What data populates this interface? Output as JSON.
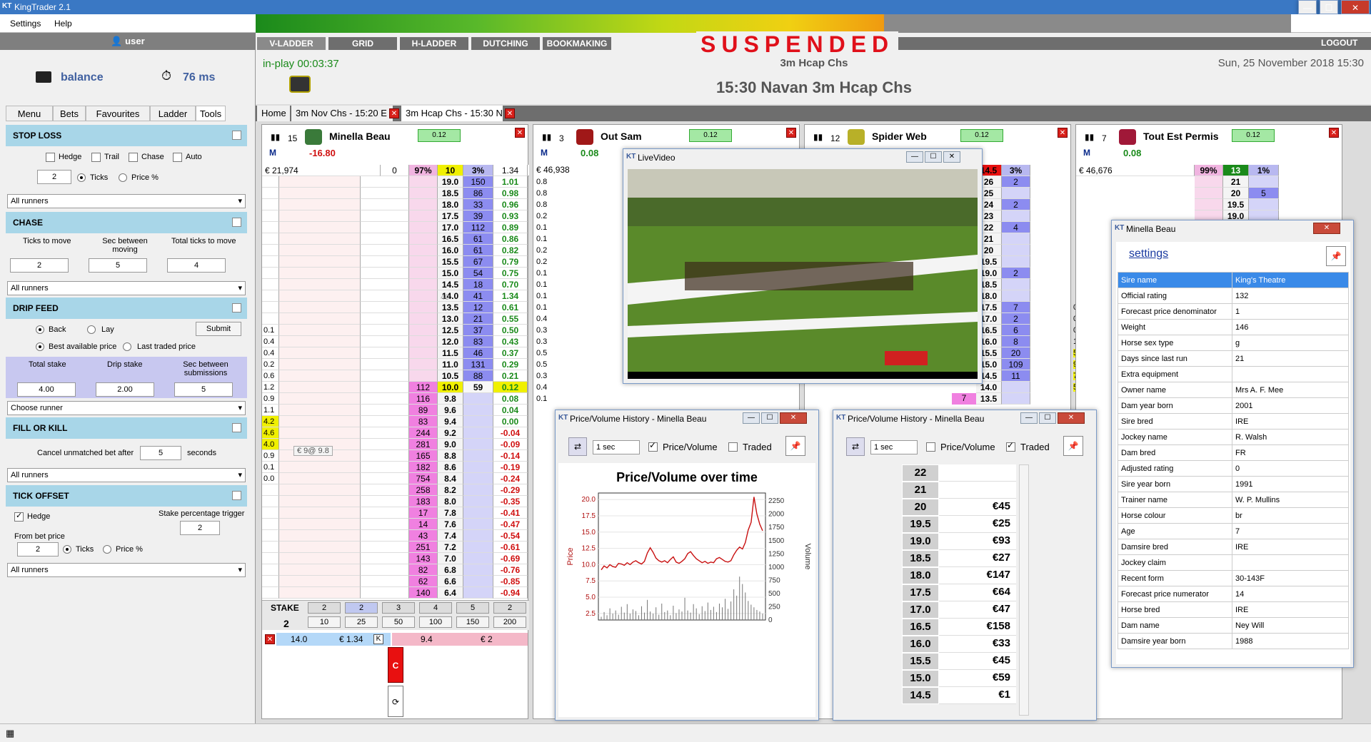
{
  "app": {
    "title": "KingTrader 2.1",
    "logo": "KT"
  },
  "menu": [
    "Settings",
    "Help"
  ],
  "user": {
    "name": "user",
    "balance_label": "balance",
    "latency": "76 ms"
  },
  "left_tabs": [
    "Menu",
    "Bets",
    "Favourites",
    "Ladder",
    "Tools"
  ],
  "stop_loss": {
    "title": "STOP LOSS",
    "hedge": "Hedge",
    "trail": "Trail",
    "chase": "Chase",
    "auto": "Auto",
    "value": "2",
    "ticks": "Ticks",
    "price_pct": "Price %",
    "runners": "All runners"
  },
  "chase": {
    "title": "CHASE",
    "ticks_to_move": "Ticks to move",
    "sec_between": "Sec between moving",
    "total_ticks": "Total ticks to move",
    "v1": "2",
    "v2": "5",
    "v3": "4",
    "runners": "All runners"
  },
  "drip": {
    "title": "DRIP FEED",
    "back": "Back",
    "lay": "Lay",
    "submit": "Submit",
    "best": "Best available price",
    "last": "Last traded price",
    "total_stake": "Total stake",
    "drip_stake": "Drip stake",
    "sec_sub": "Sec between submissions",
    "v1": "4.00",
    "v2": "2.00",
    "v3": "5",
    "runner": "Choose runner"
  },
  "fok": {
    "title": "FILL OR KILL",
    "cancel": "Cancel unmatched bet after",
    "value": "5",
    "seconds": "seconds",
    "runners": "All runners"
  },
  "tick": {
    "title": "TICK OFFSET",
    "hedge": "Hedge",
    "stake_trig": "Stake percentage trigger",
    "trig_val": "2",
    "from": "From bet price",
    "value": "2",
    "ticks": "Ticks",
    "price_pct": "Price %",
    "runners": "All runners"
  },
  "nav": [
    "V-LADDER",
    "GRID",
    "H-LADDER",
    "DUTCHING",
    "BOOKMAKING"
  ],
  "logout": "LOGOUT",
  "status": {
    "suspended": "SUSPENDED",
    "subtitle": "3m Hcap Chs",
    "inplay": "in-play 00:03:37",
    "race": "15:30 Navan 3m Hcap Chs",
    "date": "Sun, 25 November 2018 15:30"
  },
  "doc_tabs": [
    "Home",
    "3m Nov Chs - 15:20 E",
    "3m Hcap Chs - 15:30 N"
  ],
  "runners": [
    {
      "num": "15",
      "name": "Minella Beau",
      "pill": "0.12",
      "pl": "-16.80",
      "total": "€ 21,974",
      "zero": "0",
      "pct1": "97%",
      "ltp": "10",
      "pct2": "3%",
      "v": "1.34"
    },
    {
      "num": "3",
      "name": "Out Sam",
      "pill": "0.12",
      "pl": "0.08",
      "total": "€ 46,938"
    },
    {
      "num": "12",
      "name": "Spider Web",
      "pill": "0.12",
      "pl": "",
      "total": ""
    },
    {
      "num": "7",
      "name": "Tout Est Permis",
      "pill": "0.12",
      "pl": "0.08",
      "total": "€ 46,676",
      "pct1": "99%",
      "ltp": "13",
      "pct2": "1%"
    }
  ],
  "ladder1": [
    {
      "l": "",
      "b": "",
      "p": "19.0",
      "lay": "150",
      "r": "1.01"
    },
    {
      "l": "",
      "b": "",
      "p": "18.5",
      "lay": "86",
      "r": "0.98"
    },
    {
      "l": "",
      "b": "",
      "p": "18.0",
      "lay": "33",
      "r": "0.96"
    },
    {
      "l": "",
      "b": "",
      "p": "17.5",
      "lay": "39",
      "r": "0.93"
    },
    {
      "l": "",
      "b": "",
      "p": "17.0",
      "lay": "112",
      "r": "0.89"
    },
    {
      "l": "",
      "b": "",
      "p": "16.5",
      "lay": "61",
      "r": "0.86"
    },
    {
      "l": "",
      "b": "",
      "p": "16.0",
      "lay": "61",
      "r": "0.82"
    },
    {
      "l": "",
      "b": "",
      "p": "15.5",
      "lay": "67",
      "r": "0.79"
    },
    {
      "l": "",
      "b": "",
      "p": "15.0",
      "lay": "54",
      "r": "0.75"
    },
    {
      "l": "",
      "b": "",
      "p": "14.5",
      "lay": "18",
      "r": "0.70"
    },
    {
      "l": "",
      "b": "",
      "p": "14.0",
      "lay": "41",
      "r": "1.34"
    },
    {
      "l": "",
      "b": "",
      "p": "13.5",
      "lay": "12",
      "r": "0.61"
    },
    {
      "l": "",
      "b": "",
      "p": "13.0",
      "lay": "21",
      "r": "0.55"
    },
    {
      "l": "0.1",
      "b": "",
      "p": "12.5",
      "lay": "37",
      "r": "0.50"
    },
    {
      "l": "0.4",
      "b": "",
      "p": "12.0",
      "lay": "83",
      "r": "0.43"
    },
    {
      "l": "0.4",
      "b": "",
      "p": "11.5",
      "lay": "46",
      "r": "0.37"
    },
    {
      "l": "0.2",
      "b": "",
      "p": "11.0",
      "lay": "131",
      "r": "0.29"
    },
    {
      "l": "0.6",
      "b": "",
      "p": "10.5",
      "lay": "88",
      "r": "0.21"
    },
    {
      "l": "1.2",
      "b": "112",
      "p": "10.0",
      "lay": "59",
      "r": "0.12"
    },
    {
      "l": "0.9",
      "b": "116",
      "p": "9.8",
      "lay": "",
      "r": "0.08"
    },
    {
      "l": "1.1",
      "b": "89",
      "p": "9.6",
      "lay": "",
      "r": "0.04"
    },
    {
      "l": "4.2",
      "b": "83",
      "p": "9.4",
      "lay": "",
      "r": "0.00"
    },
    {
      "l": "4.6",
      "b": "244",
      "p": "9.2",
      "lay": "",
      "r": "-0.04"
    },
    {
      "l": "4.0",
      "b": "281",
      "p": "9.0",
      "lay": "",
      "r": "-0.09"
    },
    {
      "l": "0.9",
      "b": "165",
      "p": "8.8",
      "lay": "",
      "r": "-0.14"
    },
    {
      "l": "0.1",
      "b": "182",
      "p": "8.6",
      "lay": "",
      "r": "-0.19"
    },
    {
      "l": "0.0",
      "b": "754",
      "p": "8.4",
      "lay": "",
      "r": "-0.24"
    },
    {
      "l": "",
      "b": "258",
      "p": "8.2",
      "lay": "",
      "r": "-0.29"
    },
    {
      "l": "",
      "b": "183",
      "p": "8.0",
      "lay": "",
      "r": "-0.35"
    },
    {
      "l": "",
      "b": "17",
      "p": "7.8",
      "lay": "",
      "r": "-0.41"
    },
    {
      "l": "",
      "b": "14",
      "p": "7.6",
      "lay": "",
      "r": "-0.47"
    },
    {
      "l": "",
      "b": "43",
      "p": "7.4",
      "lay": "",
      "r": "-0.54"
    },
    {
      "l": "",
      "b": "251",
      "p": "7.2",
      "lay": "",
      "r": "-0.61"
    },
    {
      "l": "",
      "b": "143",
      "p": "7.0",
      "lay": "",
      "r": "-0.69"
    },
    {
      "l": "",
      "b": "82",
      "p": "6.8",
      "lay": "",
      "r": "-0.76"
    },
    {
      "l": "",
      "b": "62",
      "p": "6.6",
      "lay": "",
      "r": "-0.85"
    },
    {
      "l": "",
      "b": "140",
      "p": "6.4",
      "lay": "",
      "r": "-0.94"
    }
  ],
  "ladder1_extra": {
    "ghost": "40",
    "pos": "€ 9@ 9.8"
  },
  "ladder2_left": [
    "0.8",
    "0.8",
    "0.8",
    "0.2",
    "0.1",
    "0.1",
    "0.2",
    "0.2",
    "0.1",
    "0.1",
    "0.1",
    "0.1",
    "0.4",
    "0.3",
    "0.3",
    "0.5",
    "0.5",
    "0.3",
    "0.4",
    "0.1"
  ],
  "stake": {
    "label": "STAKE",
    "top": [
      "2",
      "2",
      "3",
      "4",
      "5",
      "2"
    ],
    "value": "2",
    "bottom": [
      "10",
      "25",
      "50",
      "100",
      "150",
      "200"
    ]
  },
  "bet_row": {
    "a": "14.0",
    "b": "€ 1.34",
    "k": "K",
    "c": "9.4",
    "d": "€ 2",
    "cbtn": "C"
  },
  "ladder3": [
    {
      "p": "14.5",
      "pct": "3%",
      "lay": ""
    },
    {
      "p": "26",
      "lay": "2"
    },
    {
      "p": "25",
      "lay": ""
    },
    {
      "p": "24",
      "lay": "2"
    },
    {
      "p": "23",
      "lay": ""
    },
    {
      "p": "22",
      "lay": "4"
    },
    {
      "p": "21",
      "lay": ""
    },
    {
      "p": "20",
      "lay": ""
    },
    {
      "p": "19.5",
      "lay": ""
    },
    {
      "p": "19.0",
      "lay": "2"
    },
    {
      "p": "18.5",
      "lay": ""
    },
    {
      "p": "18.0",
      "lay": ""
    },
    {
      "p": "17.5",
      "lay": "7"
    },
    {
      "p": "17.0",
      "lay": "2"
    },
    {
      "p": "16.5",
      "lay": "6"
    },
    {
      "p": "16.0",
      "lay": "8"
    },
    {
      "p": "15.5",
      "lay": "20"
    },
    {
      "p": "15.0",
      "lay": "109"
    },
    {
      "p": "14.5",
      "lay": "11"
    },
    {
      "p": "14.0",
      "lay": ""
    },
    {
      "p": "13.5",
      "lay": ""
    }
  ],
  "ladder3_left": [
    "0.0",
    "0.7",
    "0.9",
    "1.0",
    "5.7",
    "9.8",
    "7.6",
    "5.3"
  ],
  "ladder3_back7": "7",
  "ladder4": [
    "21",
    "20",
    "19.5",
    "19.0"
  ],
  "ladder4_lay": "5",
  "video": {
    "title": "LiveVideo"
  },
  "pv1": {
    "title": "Price/Volume History - Minella Beau",
    "interval": "1 sec",
    "pv": "Price/Volume",
    "traded": "Traded",
    "chart_title": "Price/Volume over time"
  },
  "pv2": {
    "title": "Price/Volume History - Minella Beau",
    "interval": "1 sec",
    "pv": "Price/Volume",
    "traded": "Traded",
    "rows": [
      [
        "22",
        ""
      ],
      [
        "21",
        ""
      ],
      [
        "20",
        "€45"
      ],
      [
        "19.5",
        "€25"
      ],
      [
        "19.0",
        "€93"
      ],
      [
        "18.5",
        "€27"
      ],
      [
        "18.0",
        "€147"
      ],
      [
        "17.5",
        "€64"
      ],
      [
        "17.0",
        "€47"
      ],
      [
        "16.5",
        "€158"
      ],
      [
        "16.0",
        "€33"
      ],
      [
        "15.5",
        "€45"
      ],
      [
        "15.0",
        "€59"
      ],
      [
        "14.5",
        "€1"
      ]
    ]
  },
  "info": {
    "title": "Minella Beau",
    "settings": "settings",
    "rows": [
      [
        "Sire name",
        "King's Theatre"
      ],
      [
        "Official rating",
        "132"
      ],
      [
        "Forecast price denominator",
        "1"
      ],
      [
        "Weight",
        "146"
      ],
      [
        "Horse sex type",
        "g"
      ],
      [
        "Days since last run",
        "21"
      ],
      [
        "Extra equipment",
        ""
      ],
      [
        "Owner name",
        "Mrs A. F. Mee"
      ],
      [
        "Dam year born",
        "2001"
      ],
      [
        "Sire bred",
        "IRE"
      ],
      [
        "Jockey name",
        "R. Walsh"
      ],
      [
        "Dam bred",
        "FR"
      ],
      [
        "Adjusted rating",
        "0"
      ],
      [
        "Sire year born",
        "1991"
      ],
      [
        "Trainer name",
        "W. P. Mullins"
      ],
      [
        "Horse colour",
        "br"
      ],
      [
        "Age",
        "7"
      ],
      [
        "Damsire bred",
        "IRE"
      ],
      [
        "Jockey claim",
        ""
      ],
      [
        "Recent form",
        "30-143F"
      ],
      [
        "Forecast price numerator",
        "14"
      ],
      [
        "Horse bred",
        "IRE"
      ],
      [
        "Dam name",
        "Ney Will"
      ],
      [
        "Damsire year born",
        "1988"
      ]
    ]
  },
  "chart_data": {
    "type": "line",
    "title": "Price/Volume over time",
    "ylabel": "Price",
    "y2label": "Volume",
    "ylim": [
      1.5,
      21
    ],
    "y2lim": [
      0,
      2400
    ],
    "yticks": [
      "2.5",
      "5.0",
      "7.5",
      "10.0",
      "12.5",
      "15.0",
      "17.5",
      "20.0"
    ],
    "y2ticks": [
      "0",
      "250",
      "500",
      "750",
      "1000",
      "1250",
      "1500",
      "1750",
      "2000",
      "2250"
    ],
    "series": [
      {
        "values": [
          9.2,
          9.8,
          9.5,
          10.0,
          9.7,
          9.6,
          10.2,
          10.1,
          9.9,
          10.3,
          10.0,
          10.4,
          10.6,
          10.3,
          10.1,
          10.5,
          11.8,
          12.6,
          11.9,
          11.0,
          10.6,
          10.4,
          10.6,
          10.3,
          10.8,
          11.2,
          10.4,
          10.2,
          10.5,
          10.9,
          11.7,
          12.0,
          11.4,
          10.9,
          10.6,
          10.3,
          10.5,
          10.2,
          10.4,
          10.3,
          10.9,
          11.1,
          10.8,
          10.5,
          10.4,
          10.6,
          11.5,
          12.2,
          12.7,
          12.4,
          13.4,
          15.3,
          16.5,
          20.4,
          17.8,
          16.2,
          15.2
        ]
      },
      {
        "values": [
          60,
          150,
          90,
          220,
          120,
          180,
          100,
          250,
          140,
          300,
          120,
          200,
          170,
          90,
          260,
          140,
          380,
          160,
          120,
          240,
          100,
          310,
          150,
          180,
          90,
          270,
          130,
          200,
          160,
          420,
          180,
          140,
          300,
          220,
          110,
          260,
          170,
          330,
          190,
          250,
          150,
          310,
          240,
          400,
          210,
          350,
          580,
          460,
          820,
          680,
          520,
          360,
          290,
          240,
          190,
          160,
          120
        ]
      }
    ]
  }
}
